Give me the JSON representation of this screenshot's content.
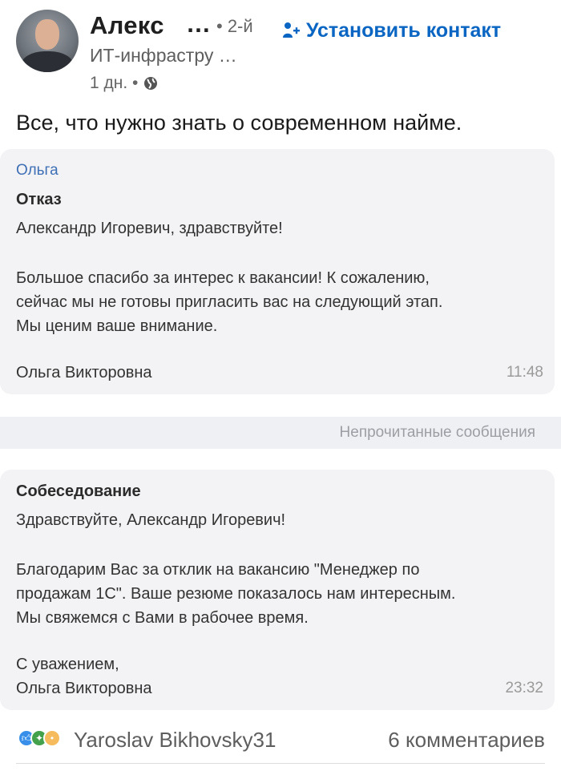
{
  "post": {
    "author_name": "Алекс",
    "author_name_more": "…",
    "degree": "• 2-й",
    "connect_label": "Установить контакт",
    "headline": "ИТ-инфрастру …",
    "time": "1 дн. •",
    "text": "Все, что нужно знать о современном найме."
  },
  "messages": [
    {
      "sender": "Ольга",
      "subject": "Отказ",
      "lines": [
        "Александр Игоревич, здравствуйте!",
        "",
        "Большое спасибо за интерес к вакансии! К сожалению,",
        "сейчас мы не готовы пригласить вас на следующий этап.",
        "Мы ценим ваше внимание.",
        "",
        "Ольга Викторовна"
      ],
      "time": "11:48"
    },
    {
      "subject": "Собеседование",
      "lines": [
        "Здравствуйте, Александр Игоревич!",
        "",
        "Благодарим Вас за отклик на вакансию \"Менеджер по",
        "продажам 1С\". Ваше резюме показалось нам интересным.",
        "Мы свяжемся с Вами в рабочее время.",
        "",
        "С уважением,",
        "Ольга Викторовна"
      ],
      "time": "23:32"
    }
  ],
  "unread_label": "Непрочитанные сообщения",
  "footer": {
    "reactor": "Yaroslav Bikhovsky31",
    "comments": "6 комментариев",
    "reaction_icons": [
      "like-icon",
      "celebrate-icon",
      "insightful-icon"
    ]
  },
  "colors": {
    "link_blue": "#0a66c2",
    "card_bg": "#f3f3f5",
    "sender_blue": "#3f6fb5"
  }
}
